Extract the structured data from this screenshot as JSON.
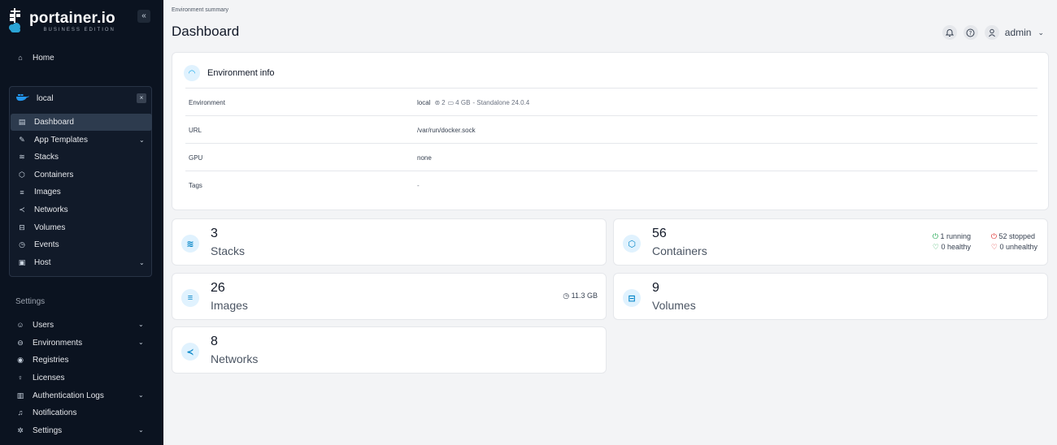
{
  "brand": {
    "name": "portainer.io",
    "edition": "BUSINESS EDITION"
  },
  "sidebar": {
    "collapse_icon": "«",
    "home_label": "Home",
    "environment": {
      "name": "local",
      "items": [
        {
          "label": "Dashboard",
          "icon": "dashboard-icon",
          "active": true
        },
        {
          "label": "App Templates",
          "icon": "edit-icon",
          "has_chevron": true
        },
        {
          "label": "Stacks",
          "icon": "layers-icon"
        },
        {
          "label": "Containers",
          "icon": "cube-icon"
        },
        {
          "label": "Images",
          "icon": "list-icon"
        },
        {
          "label": "Networks",
          "icon": "share-icon"
        },
        {
          "label": "Volumes",
          "icon": "database-icon"
        },
        {
          "label": "Events",
          "icon": "history-icon"
        },
        {
          "label": "Host",
          "icon": "server-icon",
          "has_chevron": true
        }
      ]
    },
    "settings_title": "Settings",
    "settings_items": [
      {
        "label": "Users",
        "icon": "users-icon",
        "has_chevron": true
      },
      {
        "label": "Environments",
        "icon": "hdd-icon",
        "has_chevron": true
      },
      {
        "label": "Registries",
        "icon": "radio-icon"
      },
      {
        "label": "Licenses",
        "icon": "key-icon"
      },
      {
        "label": "Authentication Logs",
        "icon": "file-icon",
        "has_chevron": true
      },
      {
        "label": "Notifications",
        "icon": "bell-icon"
      },
      {
        "label": "Settings",
        "icon": "gear-icon",
        "has_chevron": true
      }
    ]
  },
  "header": {
    "breadcrumb": "Environment summary",
    "title": "Dashboard",
    "user": "admin"
  },
  "env_info": {
    "title": "Environment info",
    "rows": [
      {
        "key": "Environment",
        "value": "local",
        "cpu": "2",
        "memory": "4 GB",
        "extra": "- Standalone 24.0.4"
      },
      {
        "key": "URL",
        "value": "/var/run/docker.sock"
      },
      {
        "key": "GPU",
        "value": "none"
      },
      {
        "key": "Tags",
        "value": "-"
      }
    ]
  },
  "stats": {
    "stacks": {
      "count": "3",
      "label": "Stacks"
    },
    "containers": {
      "count": "56",
      "label": "Containers",
      "running": "1 running",
      "stopped": "52 stopped",
      "healthy": "0 healthy",
      "unhealthy": "0 unhealthy"
    },
    "images": {
      "count": "26",
      "label": "Images",
      "size": "11.3 GB"
    },
    "volumes": {
      "count": "9",
      "label": "Volumes"
    },
    "networks": {
      "count": "8",
      "label": "Networks"
    }
  },
  "colors": {
    "sidebar_bg": "#0b1320",
    "accent": "#0ea5e9",
    "running": "#16a34a",
    "stopped": "#dc2626"
  }
}
